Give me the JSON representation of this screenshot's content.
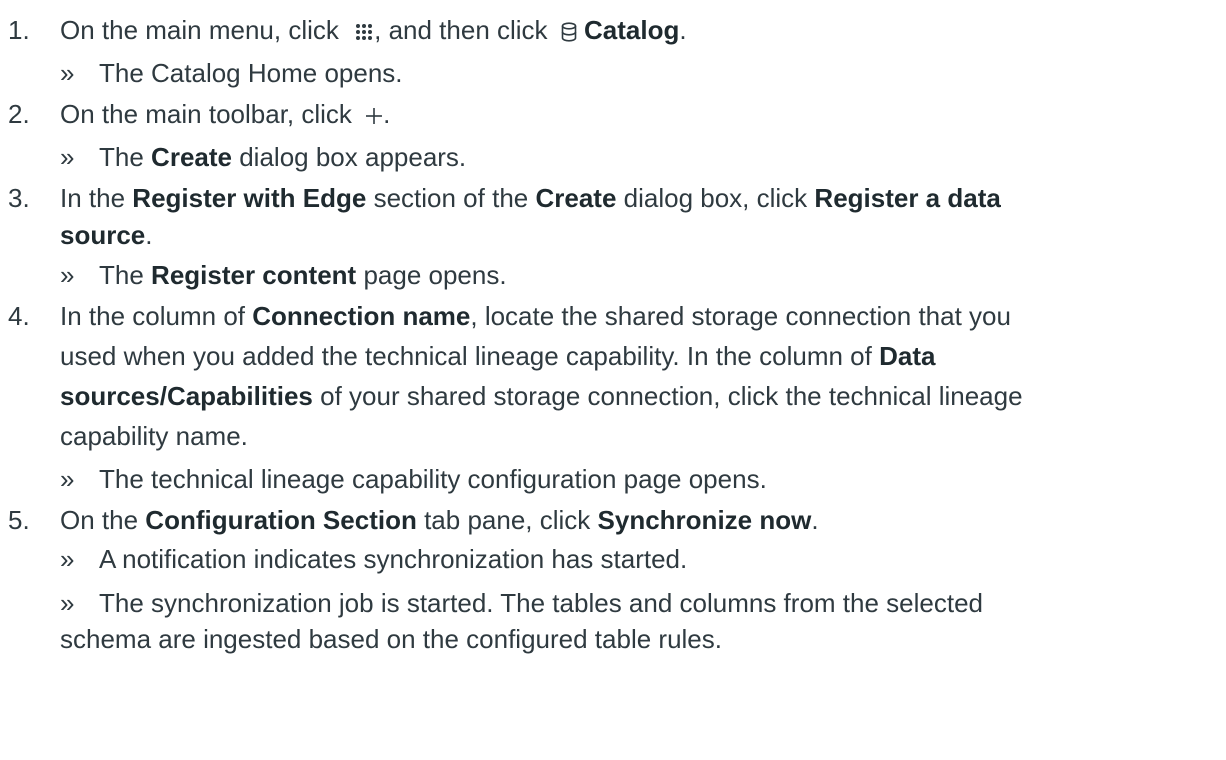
{
  "steps": [
    {
      "number": "1.",
      "parts": {
        "t1": "On the main menu, click",
        "t2": ", and then click",
        "b1": "Catalog",
        "t3": "."
      },
      "icons": [
        "grid-icon",
        "database-icon"
      ],
      "results": [
        "The Catalog Home opens."
      ]
    },
    {
      "number": "2.",
      "parts": {
        "t1": "On the main toolbar, click",
        "t2": "."
      },
      "icons": [
        "plus-icon"
      ],
      "results": {
        "r1_pre": "The",
        "r1_b": "Create",
        "r1_post": "dialog box appears."
      }
    },
    {
      "number": "3.",
      "parts": {
        "t1": "In the",
        "b1": "Register with Edge",
        "t2": "section of the",
        "b2": "Create",
        "t3": "dialog box, click",
        "b3": "Register a data",
        "b4": "source",
        "t4": "."
      },
      "results": {
        "r1_pre": "The",
        "r1_b": "Register content",
        "r1_post": "page opens."
      }
    },
    {
      "number": "4.",
      "parts": {
        "t1": "In the column of",
        "b1": "Connection name",
        "t2": ", locate the shared storage connection that you",
        "t3": "used when you added the technical lineage capability. In the column of",
        "b2": "Data",
        "b3": "sources/Capabilities",
        "t4": "of your shared storage connection, click the technical lineage",
        "t5": "capability name."
      },
      "results": [
        "The technical lineage capability configuration page opens."
      ]
    },
    {
      "number": "5.",
      "parts": {
        "t1": "On the",
        "b1": "Configuration Section",
        "t2": "tab pane, click",
        "b2": "Synchronize now",
        "t3": "."
      },
      "results": [
        "A notification indicates synchronization has started.",
        "The synchronization job is started. The tables and columns from the selected",
        "schema are ingested based on the configured table rules."
      ]
    }
  ],
  "bullet": "»"
}
